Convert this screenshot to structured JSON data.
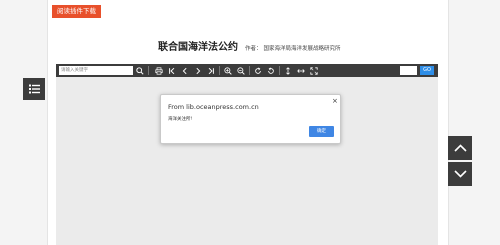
{
  "header": {
    "download_label": "阅读插件下载"
  },
  "document": {
    "title": "联合国海洋法公约",
    "author_label": "作者：",
    "author": "国家海洋局海洋发展战略研究所"
  },
  "toolbar": {
    "search_placeholder": "请输入关键字",
    "go_label": "GO",
    "icons": [
      "search-icon",
      "print-icon",
      "first-page-icon",
      "prev-page-icon",
      "next-page-icon",
      "last-page-icon",
      "zoom-in-icon",
      "zoom-out-icon",
      "rotate-cw-icon",
      "rotate-ccw-icon",
      "fit-height-icon",
      "fit-width-icon",
      "fullscreen-icon"
    ]
  },
  "dialog": {
    "title": "From lib.oceanpress.com.cn",
    "message": "海洋关注所!",
    "ok_label": "确定",
    "close_glyph": "×"
  },
  "colors": {
    "accent_download": "#e8502b",
    "toolbar_bg": "#3c3c3c",
    "go_button": "#2e8ee8",
    "dialog_ok": "#3f86e4"
  }
}
